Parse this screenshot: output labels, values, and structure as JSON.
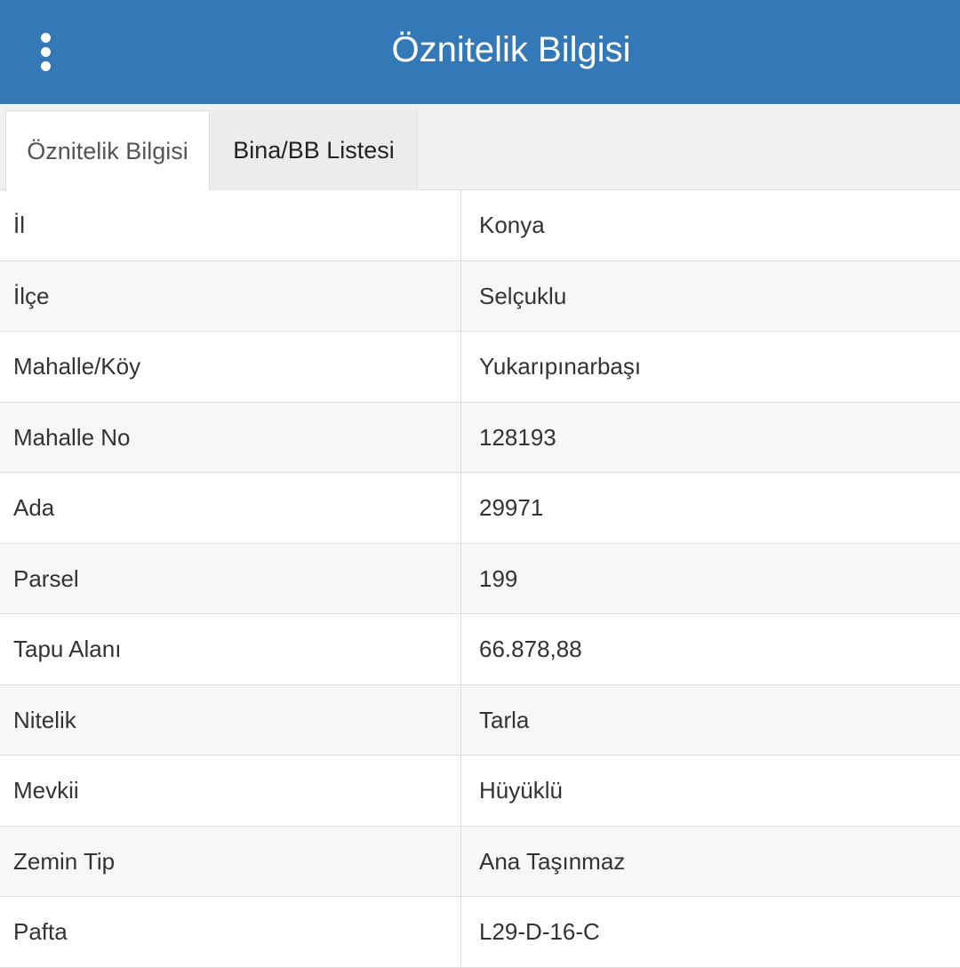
{
  "header": {
    "title": "Öznitelik Bilgisi",
    "menu_icon": "vertical-ellipsis-icon",
    "background_color": "#3379b7"
  },
  "tabs": [
    {
      "label": "Öznitelik Bilgisi",
      "active": true
    },
    {
      "label": "Bina/BB Listesi",
      "active": false
    }
  ],
  "rows": [
    {
      "label": "İl",
      "value": "Konya"
    },
    {
      "label": "İlçe",
      "value": "Selçuklu"
    },
    {
      "label": "Mahalle/Köy",
      "value": "Yukarıpınarbaşı"
    },
    {
      "label": "Mahalle No",
      "value": "128193"
    },
    {
      "label": "Ada",
      "value": "29971"
    },
    {
      "label": "Parsel",
      "value": "199"
    },
    {
      "label": "Tapu Alanı",
      "value": "66.878,88"
    },
    {
      "label": "Nitelik",
      "value": "Tarla"
    },
    {
      "label": "Mevkii",
      "value": "Hüyüklü"
    },
    {
      "label": "Zemin Tip",
      "value": "Ana Taşınmaz"
    },
    {
      "label": "Pafta",
      "value": "L29-D-16-C"
    }
  ]
}
